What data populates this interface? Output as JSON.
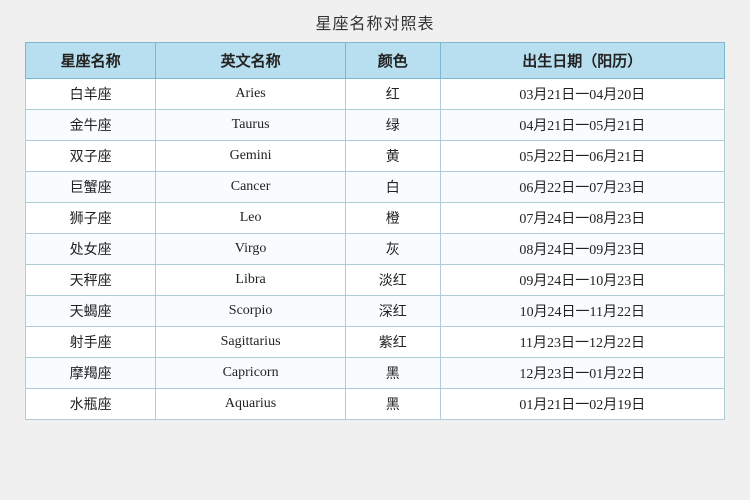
{
  "title": "星座名称对照表",
  "headers": {
    "chinese": "星座名称",
    "english": "英文名称",
    "color": "颜色",
    "date": "出生日期（阳历）"
  },
  "rows": [
    {
      "chinese": "白羊座",
      "english": "Aries",
      "color": "红",
      "date": "03月21日一04月20日"
    },
    {
      "chinese": "金牛座",
      "english": "Taurus",
      "color": "绿",
      "date": "04月21日一05月21日"
    },
    {
      "chinese": "双子座",
      "english": "Gemini",
      "color": "黄",
      "date": "05月22日一06月21日"
    },
    {
      "chinese": "巨蟹座",
      "english": "Cancer",
      "color": "白",
      "date": "06月22日一07月23日"
    },
    {
      "chinese": "狮子座",
      "english": "Leo",
      "color": "橙",
      "date": "07月24日一08月23日"
    },
    {
      "chinese": "处女座",
      "english": "Virgo",
      "color": "灰",
      "date": "08月24日一09月23日"
    },
    {
      "chinese": "天秤座",
      "english": "Libra",
      "color": "淡红",
      "date": "09月24日一10月23日"
    },
    {
      "chinese": "天蝎座",
      "english": "Scorpio",
      "color": "深红",
      "date": "10月24日一11月22日"
    },
    {
      "chinese": "射手座",
      "english": "Sagittarius",
      "color": "紫红",
      "date": "11月23日一12月22日"
    },
    {
      "chinese": "摩羯座",
      "english": "Capricorn",
      "color": "黑",
      "date": "12月23日一01月22日"
    },
    {
      "chinese": "水瓶座",
      "english": "Aquarius",
      "color": "黑",
      "date": "01月21日一02月19日"
    }
  ]
}
